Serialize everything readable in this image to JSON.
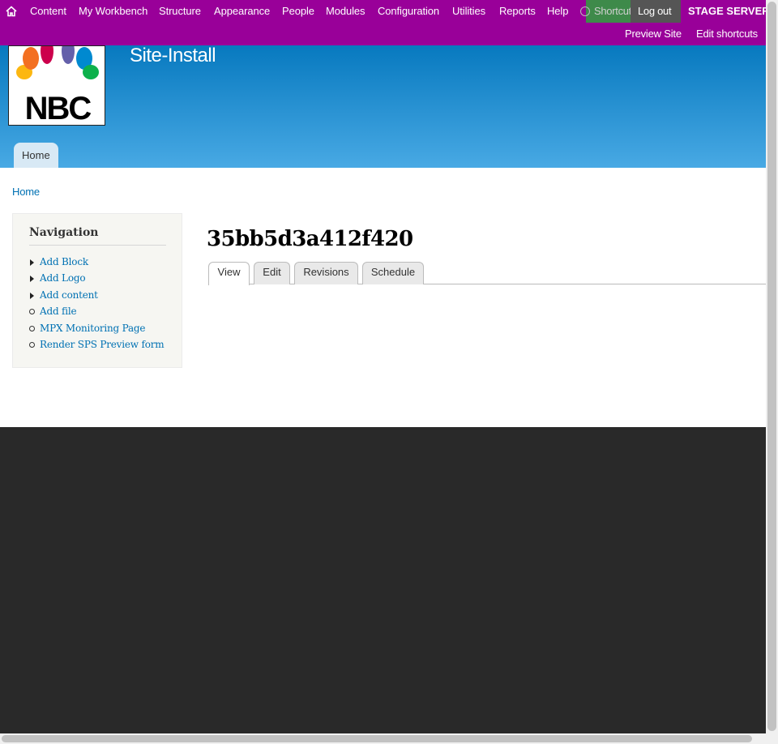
{
  "toolbar": {
    "menu": [
      {
        "label": "Content"
      },
      {
        "label": "My Workbench"
      },
      {
        "label": "Structure"
      },
      {
        "label": "Appearance"
      },
      {
        "label": "People"
      },
      {
        "label": "Modules"
      },
      {
        "label": "Configuration"
      },
      {
        "label": "Utilities"
      },
      {
        "label": "Reports"
      },
      {
        "label": "Help"
      }
    ],
    "shortcuts_label": "Shortcuts",
    "logout_label": "Log out",
    "server_label": "STAGE SERVER",
    "shortcut_links": [
      {
        "label": "Preview Site"
      },
      {
        "label": "Edit shortcuts"
      }
    ],
    "icons": {
      "home": "home-icon"
    },
    "colors": {
      "toolbar_bg": "#990099",
      "shortcuts_bg": "#3e8a4a",
      "logout_bg": "#555555"
    }
  },
  "header": {
    "logo_text": "NBC",
    "site_name": "Site-Install",
    "primary_tabs": [
      {
        "label": "Home"
      }
    ],
    "colors": {
      "gradient_top": "#0779bf",
      "gradient_bottom": "#48a9e4"
    }
  },
  "breadcrumb": {
    "label": "Home"
  },
  "sidebar": {
    "title": "Navigation",
    "items": [
      {
        "label": "Add Block",
        "bullet": "triangle"
      },
      {
        "label": "Add Logo",
        "bullet": "triangle"
      },
      {
        "label": "Add content",
        "bullet": "triangle"
      },
      {
        "label": "Add file",
        "bullet": "circle"
      },
      {
        "label": "MPX Monitoring Page",
        "bullet": "circle"
      },
      {
        "label": "Render SPS Preview form",
        "bullet": "circle"
      }
    ]
  },
  "main": {
    "title": "35bb5d3a412f420",
    "tabs": [
      {
        "label": "View",
        "active": true
      },
      {
        "label": "Edit",
        "active": false
      },
      {
        "label": "Revisions",
        "active": false
      },
      {
        "label": "Schedule",
        "active": false
      }
    ]
  },
  "footer": {
    "color": "#292929"
  }
}
